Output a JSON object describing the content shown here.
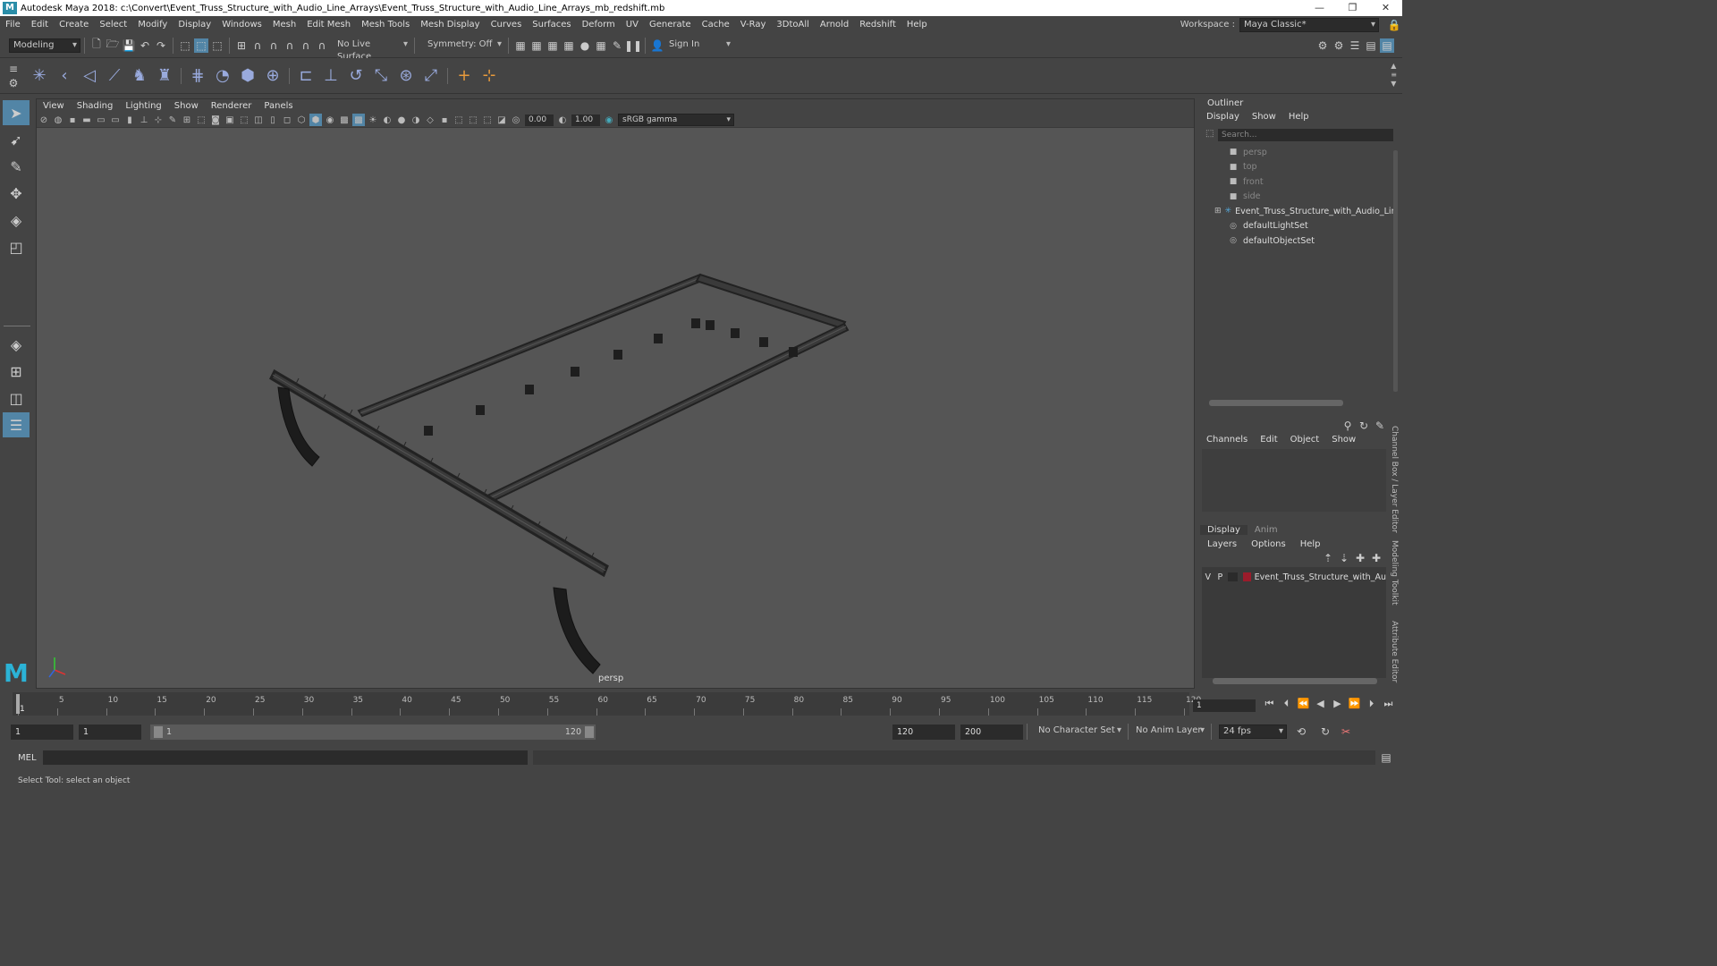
{
  "window": {
    "title": "Autodesk Maya 2018: c:\\Convert\\Event_Truss_Structure_with_Audio_Line_Arrays\\Event_Truss_Structure_with_Audio_Line_Arrays_mb_redshift.mb",
    "logo": "M"
  },
  "menu": [
    "File",
    "Edit",
    "Create",
    "Select",
    "Modify",
    "Display",
    "Windows",
    "Mesh",
    "Edit Mesh",
    "Mesh Tools",
    "Mesh Display",
    "Curves",
    "Surfaces",
    "Deform",
    "UV",
    "Generate",
    "Cache",
    "V-Ray",
    "3DtoAll",
    "Arnold",
    "Redshift",
    "Help"
  ],
  "workspace": {
    "label": "Workspace :",
    "value": "Maya Classic*"
  },
  "statusline": {
    "mode": "Modeling",
    "live_surface": "No Live Surface",
    "symmetry": "Symmetry: Off",
    "sign_in": "Sign In"
  },
  "viewport": {
    "menu": [
      "View",
      "Shading",
      "Lighting",
      "Show",
      "Renderer",
      "Panels"
    ],
    "exposure": "0.00",
    "gamma": "1.00",
    "color_space": "sRGB gamma",
    "camera_label": "persp"
  },
  "outliner": {
    "title": "Outliner",
    "menu": [
      "Display",
      "Show",
      "Help"
    ],
    "search_placeholder": "Search...",
    "items": [
      {
        "label": "persp",
        "icon": "camera-icon",
        "dim": true
      },
      {
        "label": "top",
        "icon": "camera-icon",
        "dim": true
      },
      {
        "label": "front",
        "icon": "camera-icon",
        "dim": true
      },
      {
        "label": "side",
        "icon": "camera-icon",
        "dim": true
      },
      {
        "label": "Event_Truss_Structure_with_Audio_Line_",
        "icon": "transform-icon",
        "dim": false
      },
      {
        "label": "defaultLightSet",
        "icon": "set-icon",
        "dim": false
      },
      {
        "label": "defaultObjectSet",
        "icon": "set-icon",
        "dim": false
      }
    ]
  },
  "channelbox": {
    "menu": [
      "Channels",
      "Edit",
      "Object",
      "Show"
    ]
  },
  "layereditor": {
    "tabs": [
      "Display",
      "Anim"
    ],
    "menu": [
      "Layers",
      "Options",
      "Help"
    ],
    "layer": {
      "v": "V",
      "p": "P",
      "name": "Event_Truss_Structure_with_Au",
      "color": "#9b1c2b"
    }
  },
  "sidetabs": [
    "Channel Box / Layer Editor",
    "Modeling Toolkit",
    "Attribute Editor"
  ],
  "timeline": {
    "ticks": [
      "1",
      "5",
      "10",
      "15",
      "20",
      "25",
      "30",
      "35",
      "40",
      "45",
      "50",
      "55",
      "60",
      "65",
      "70",
      "75",
      "80",
      "85",
      "90",
      "95",
      "100",
      "105",
      "110",
      "115",
      "120"
    ],
    "current_frame": "1"
  },
  "range": {
    "start": "1",
    "playback_start": "1",
    "slider_start": "1",
    "slider_end": "120",
    "playback_end": "120",
    "end": "200",
    "character_set": "No Character Set",
    "anim_layer": "No Anim Layer",
    "fps": "24 fps"
  },
  "cmdline": {
    "label": "MEL"
  },
  "help": "Select Tool: select an object"
}
